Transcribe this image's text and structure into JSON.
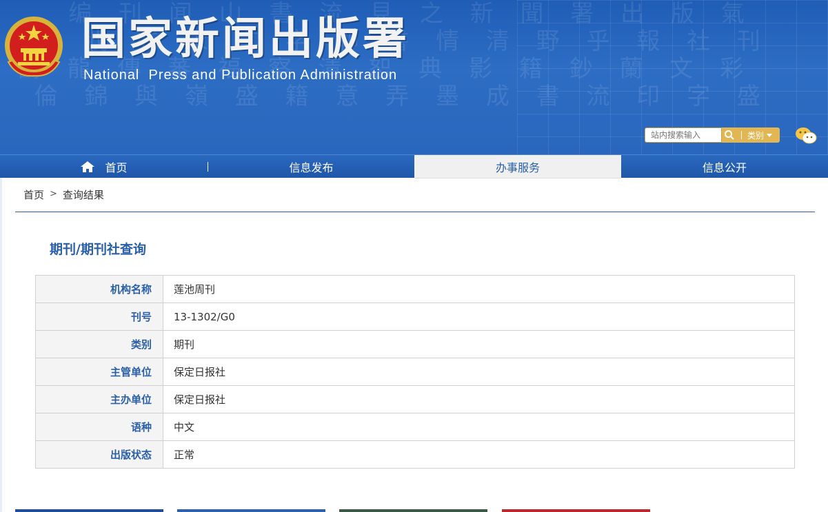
{
  "header": {
    "title": "国家新闻出版署",
    "subtitle": "National  Press and Publication Administration",
    "emblem": "national-emblem-icon"
  },
  "search": {
    "placeholder": "站内搜索输入",
    "category_label": "类别",
    "icon": "search-icon"
  },
  "nav": {
    "items": [
      {
        "label": "首页",
        "icon": "home-icon"
      },
      {
        "label": "信息发布"
      },
      {
        "label": "办事服务",
        "active": true
      },
      {
        "label": "信息公开"
      }
    ]
  },
  "breadcrumb": {
    "home": "首页",
    "separator": ">",
    "current": "查询结果"
  },
  "section": {
    "title": "期刊/期刊社查询"
  },
  "result": {
    "rows": [
      {
        "key": "机构名称",
        "value": "莲池周刊"
      },
      {
        "key": "刊号",
        "value": "13-1302/G0"
      },
      {
        "key": "类别",
        "value": "期刊"
      },
      {
        "key": "主管单位",
        "value": "保定日报社"
      },
      {
        "key": "主办单位",
        "value": "保定日报社"
      },
      {
        "key": "语种",
        "value": "中文"
      },
      {
        "key": "出版状态",
        "value": "正常"
      }
    ]
  },
  "colors": {
    "brand_blue": "#2a5fa8",
    "gold": "#e3b654",
    "footer_bars": [
      "#1f4f9a",
      "#2c62ad",
      "#3a5a48",
      "#c0272d"
    ]
  }
}
